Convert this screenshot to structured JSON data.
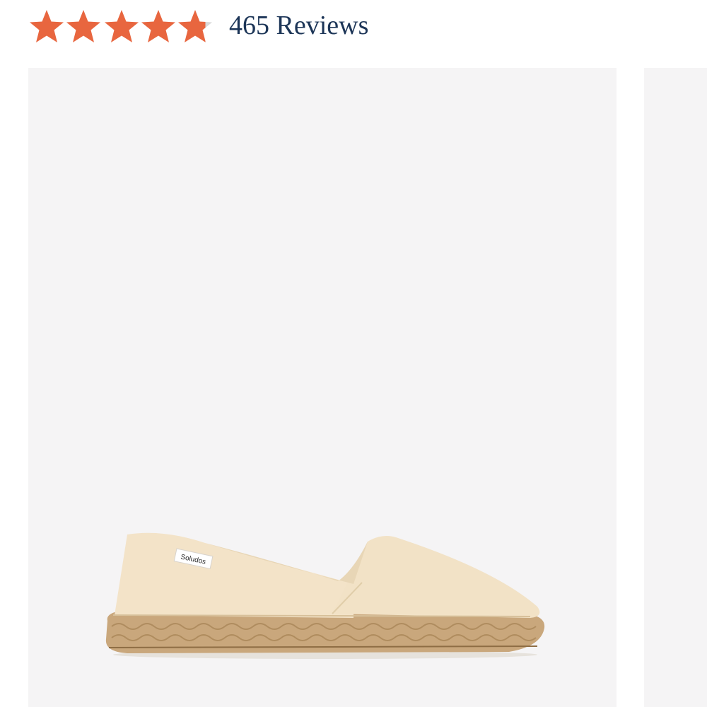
{
  "rating": {
    "stars_filled": 4.8,
    "stars_max": 5,
    "star_color": "#e8663f",
    "star_empty_color": "#d9d9d9",
    "reviews_label": "465 Reviews",
    "reviews_color": "#1c3557"
  },
  "gallery": {
    "background_color": "#f5f4f5",
    "main_image": {
      "icon": "espadrille-shoe-image",
      "brand_tag_text": "Soludos",
      "canvas_color": "#f3e3c8",
      "jute_color": "#c9a77c"
    },
    "next_image": {
      "icon": "next-product-image-partial"
    }
  }
}
